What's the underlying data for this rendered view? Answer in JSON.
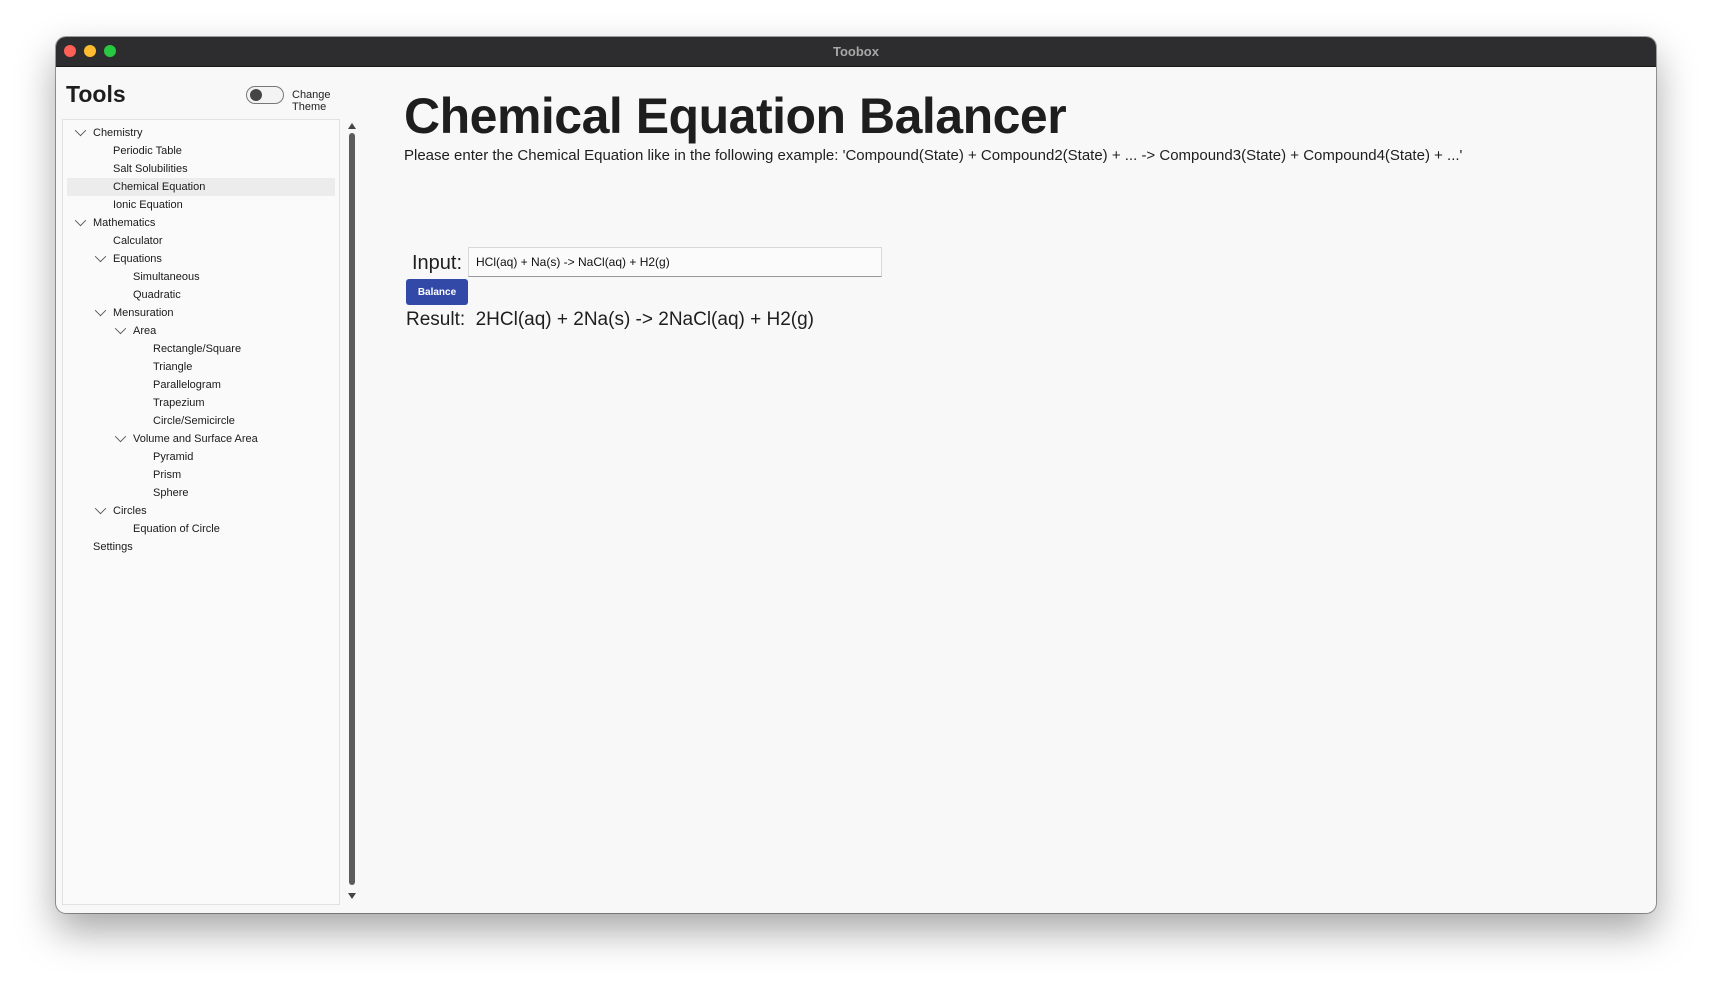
{
  "window": {
    "title": "Toobox"
  },
  "sidebar": {
    "title": "Tools",
    "theme_toggle_label": "Change Theme",
    "items": [
      {
        "label": "Chemistry",
        "depth": 0,
        "expandable": true
      },
      {
        "label": "Periodic Table",
        "depth": 1
      },
      {
        "label": "Salt Solubilities",
        "depth": 1
      },
      {
        "label": "Chemical Equation",
        "depth": 1,
        "selected": true
      },
      {
        "label": "Ionic Equation",
        "depth": 1
      },
      {
        "label": "Mathematics",
        "depth": 0,
        "expandable": true
      },
      {
        "label": "Calculator",
        "depth": 1
      },
      {
        "label": "Equations",
        "depth": 1,
        "expandable": true
      },
      {
        "label": "Simultaneous",
        "depth": 2
      },
      {
        "label": "Quadratic",
        "depth": 2
      },
      {
        "label": "Mensuration",
        "depth": 1,
        "expandable": true
      },
      {
        "label": "Area",
        "depth": 2,
        "expandable": true
      },
      {
        "label": "Rectangle/Square",
        "depth": 3
      },
      {
        "label": "Triangle",
        "depth": 3
      },
      {
        "label": "Parallelogram",
        "depth": 3
      },
      {
        "label": "Trapezium",
        "depth": 3
      },
      {
        "label": "Circle/Semicircle",
        "depth": 3
      },
      {
        "label": "Volume and Surface Area",
        "depth": 2,
        "expandable": true
      },
      {
        "label": "Pyramid",
        "depth": 3
      },
      {
        "label": "Prism",
        "depth": 3
      },
      {
        "label": "Sphere",
        "depth": 3
      },
      {
        "label": "Circles",
        "depth": 1,
        "expandable": true
      },
      {
        "label": "Equation of Circle",
        "depth": 2
      },
      {
        "label": "Settings",
        "depth": 0
      }
    ]
  },
  "main": {
    "title": "Chemical Equation Balancer",
    "instructions": "Please enter the Chemical Equation like in the following example: 'Compound(State) + Compound2(State) + ... -> Compound3(State) + Compound4(State) + ...'",
    "input_label": "Input:",
    "input_value": "HCl(aq) + Na(s) -> NaCl(aq) + H2(g)",
    "balance_label": "Balance",
    "result_label": "Result:",
    "result_value": "2HCl(aq) + 2Na(s) -> 2NaCl(aq) + H2(g)"
  },
  "colors": {
    "accent": "#3249a8",
    "titlebar": "#2d2d2f",
    "background": "#f8f8f8"
  }
}
